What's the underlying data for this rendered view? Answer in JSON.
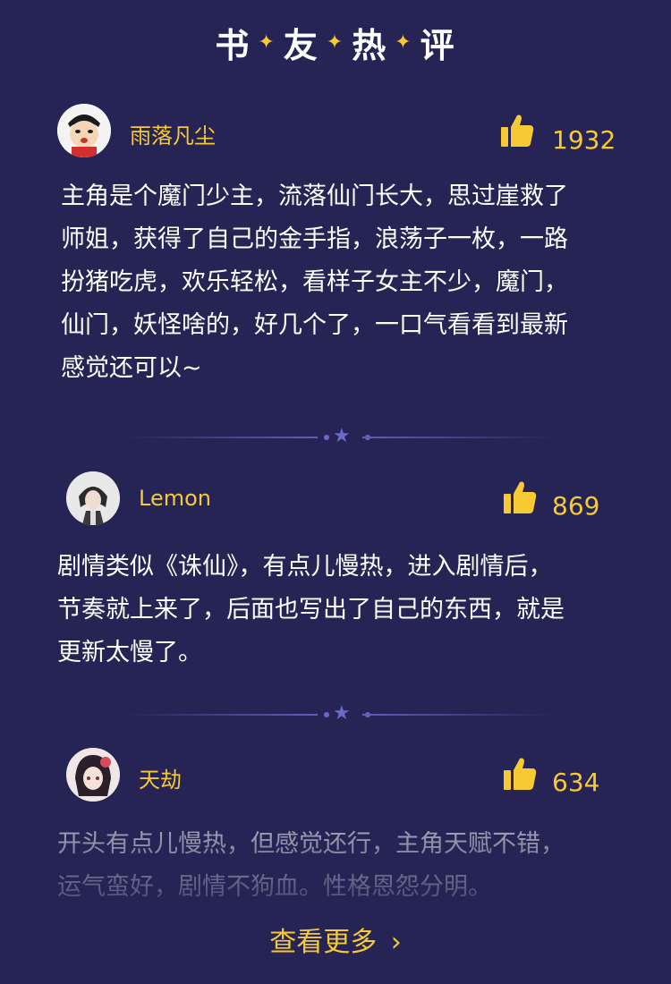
{
  "header": {
    "title_chars": [
      "书",
      "友",
      "热",
      "评"
    ],
    "spark": "✦"
  },
  "reviews": [
    {
      "username": "雨落凡尘",
      "likes": "1932",
      "lines": [
        "主角是个魔门少主，流落仙门长大，思过崖救了",
        "师姐，获得了自己的金手指，浪荡子一枚，一路",
        "扮猪吃虎，欢乐轻松，看样子女主不少，魔门，",
        "仙门，妖怪啥的，好几个了，一口气看看到最新",
        "感觉还可以~"
      ]
    },
    {
      "username": "Lemon",
      "likes": "869",
      "lines": [
        "剧情类似《诛仙》，有点儿慢热，进入剧情后，",
        "节奏就上来了，后面也写出了自己的东西，就是",
        "更新太慢了。"
      ]
    },
    {
      "username": "天劫",
      "likes": "634",
      "lines": [
        "开头有点儿慢热，但感觉还行，主角天赋不错，",
        "运气蛮好，剧情不狗血。性格恩怨分明。"
      ]
    }
  ],
  "footer": {
    "more_label": "查看更多",
    "more_arrow": "›"
  },
  "colors": {
    "background": "#252455",
    "accent": "#f7c933",
    "divider": "#5f5fb9"
  }
}
